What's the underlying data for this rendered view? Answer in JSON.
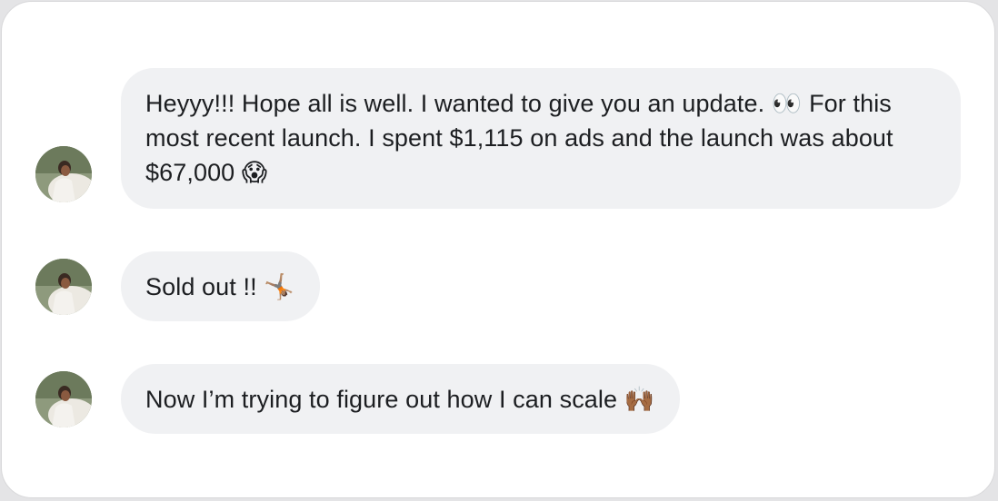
{
  "messages": [
    {
      "text": "Heyyy!!! Hope all is well. I wanted to give you an update. 👀 For this most recent launch. I spent $1,115 on ads and the launch was about $67,000 😱"
    },
    {
      "text": "Sold out !! 🤸🏽"
    },
    {
      "text": "Now I’m trying to figure out how I can scale 🙌🏾"
    }
  ],
  "avatar": {
    "icon": "profile-photo"
  }
}
